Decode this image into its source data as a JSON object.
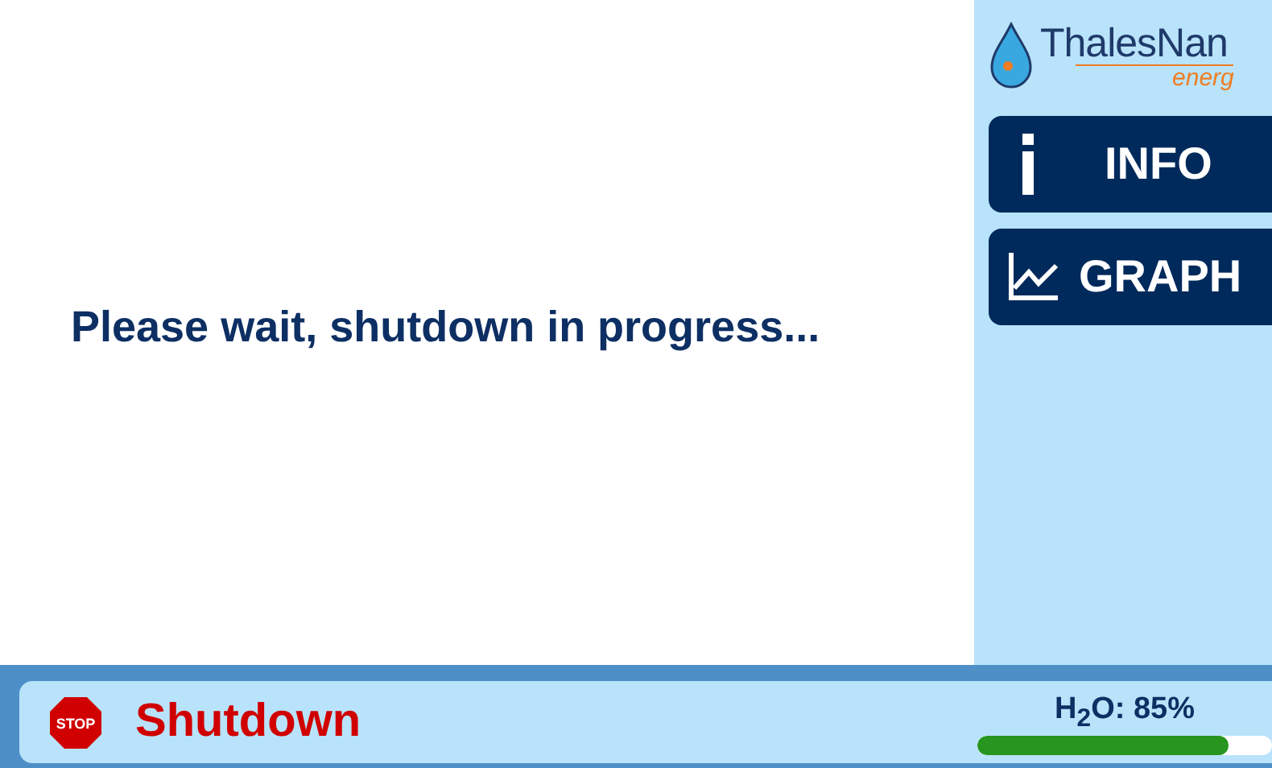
{
  "message": "Please wait, shutdown in progress...",
  "logo": {
    "name": "ThalesNan",
    "tagline": "energ"
  },
  "sidebar": {
    "buttons": [
      {
        "kind": "info",
        "label": "INFO"
      },
      {
        "kind": "graph",
        "label": "GRAPH"
      }
    ]
  },
  "status_bar": {
    "stop_sign": "STOP",
    "status": "Shutdown",
    "water": {
      "reading": "H$_{2}$O: 85%",
      "level": 0.85
    }
  }
}
